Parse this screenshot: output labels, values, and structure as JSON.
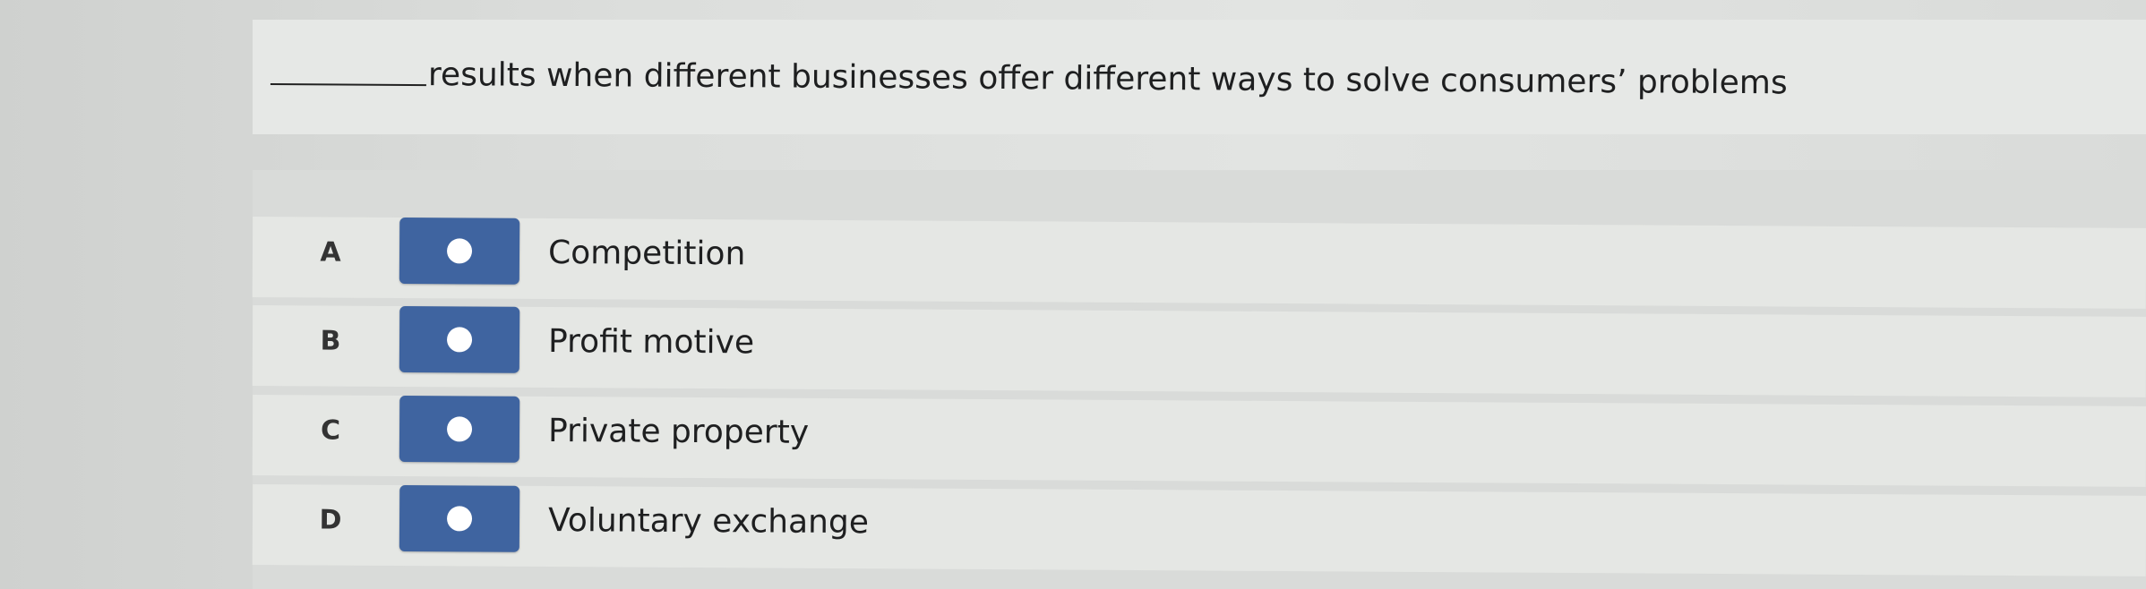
{
  "question": {
    "text": "results when different businesses offer different ways to solve consumers’ problems"
  },
  "options": [
    {
      "letter": "A",
      "label": "Competition"
    },
    {
      "letter": "B",
      "label": "Profit motive"
    },
    {
      "letter": "C",
      "label": "Private property"
    },
    {
      "letter": "D",
      "label": "Voluntary exchange"
    }
  ],
  "colors": {
    "radio_button": "#3f64a0",
    "radio_dot": "#ffffff",
    "row_background": "#e5e7e4"
  }
}
